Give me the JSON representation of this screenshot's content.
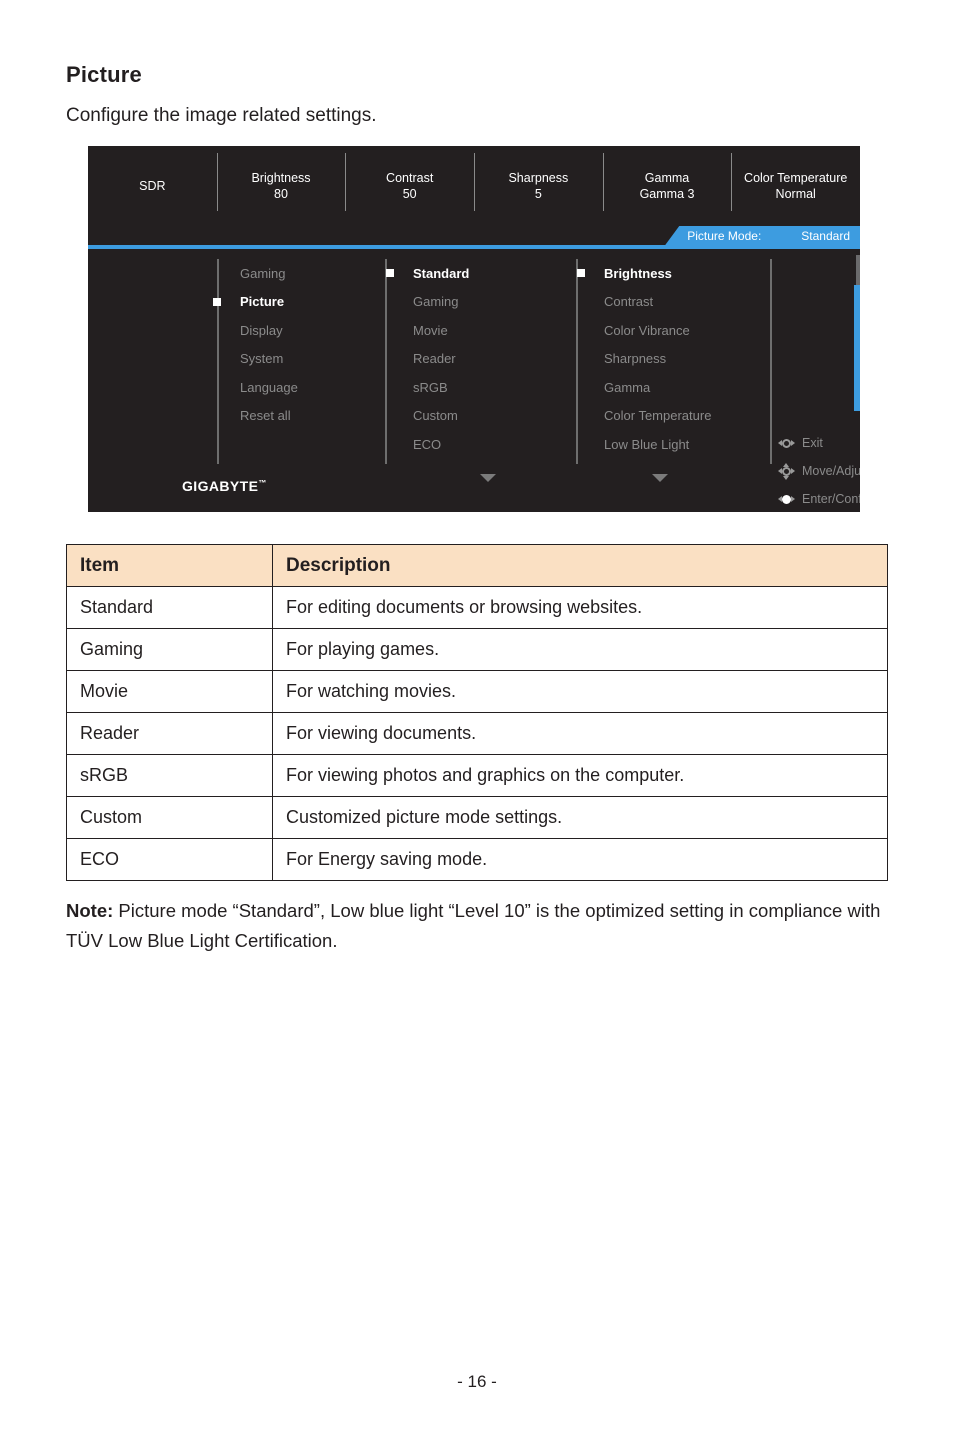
{
  "page": {
    "title": "Picture",
    "subtitle": "Configure the image related settings.",
    "page_number": "- 16 -"
  },
  "osd": {
    "brand": "GIGABYTE",
    "brand_mark": "™",
    "accent_color": "#3d9ce0",
    "background_color": "#231f20",
    "quick_info": [
      {
        "label": "SDR",
        "value": ""
      },
      {
        "label": "Brightness",
        "value": "80"
      },
      {
        "label": "Contrast",
        "value": "50"
      },
      {
        "label": "Sharpness",
        "value": "5"
      },
      {
        "label": "Gamma",
        "value": "Gamma 3"
      },
      {
        "label": "Color Temperature",
        "value": "Normal"
      }
    ],
    "picture_mode": {
      "label": "Picture Mode:",
      "value": "Standard"
    },
    "menu_column_1": [
      {
        "label": "Gaming",
        "selected": false
      },
      {
        "label": "Picture",
        "selected": true
      },
      {
        "label": "Display",
        "selected": false
      },
      {
        "label": "System",
        "selected": false
      },
      {
        "label": "Language",
        "selected": false
      },
      {
        "label": "Reset all",
        "selected": false
      }
    ],
    "menu_column_2": [
      {
        "label": "Standard",
        "selected": true
      },
      {
        "label": "Gaming",
        "selected": false
      },
      {
        "label": "Movie",
        "selected": false
      },
      {
        "label": "Reader",
        "selected": false
      },
      {
        "label": "sRGB",
        "selected": false
      },
      {
        "label": "Custom",
        "selected": false
      },
      {
        "label": "ECO",
        "selected": false
      }
    ],
    "menu_column_3": [
      {
        "label": "Brightness",
        "selected": true
      },
      {
        "label": "Contrast",
        "selected": false
      },
      {
        "label": "Color Vibrance",
        "selected": false
      },
      {
        "label": "Sharpness",
        "selected": false
      },
      {
        "label": "Gamma",
        "selected": false
      },
      {
        "label": "Color Temperature",
        "selected": false
      },
      {
        "label": "Low Blue Light",
        "selected": false
      }
    ],
    "slider": {
      "value": "80"
    },
    "hints": [
      {
        "label": "Exit",
        "icon": "joystick-left-right-icon"
      },
      {
        "label": "Move/Adjust",
        "icon": "joystick-four-way-icon"
      },
      {
        "label": "Enter/Confirm",
        "icon": "joystick-press-icon"
      }
    ]
  },
  "table": {
    "headers": [
      "Item",
      "Description"
    ],
    "header_background": "#fae0c3",
    "rows": [
      [
        "Standard",
        "For editing documents or browsing websites."
      ],
      [
        "Gaming",
        "For playing games."
      ],
      [
        "Movie",
        "For watching movies."
      ],
      [
        "Reader",
        "For viewing documents."
      ],
      [
        "sRGB",
        "For viewing photos and graphics on the computer."
      ],
      [
        "Custom",
        "Customized picture mode settings."
      ],
      [
        "ECO",
        "For Energy saving mode."
      ]
    ]
  },
  "note": {
    "label": "Note:",
    "text": " Picture mode “Standard”, Low blue light “Level 10” is the optimized setting in compliance with TÜV Low Blue Light Certification."
  }
}
